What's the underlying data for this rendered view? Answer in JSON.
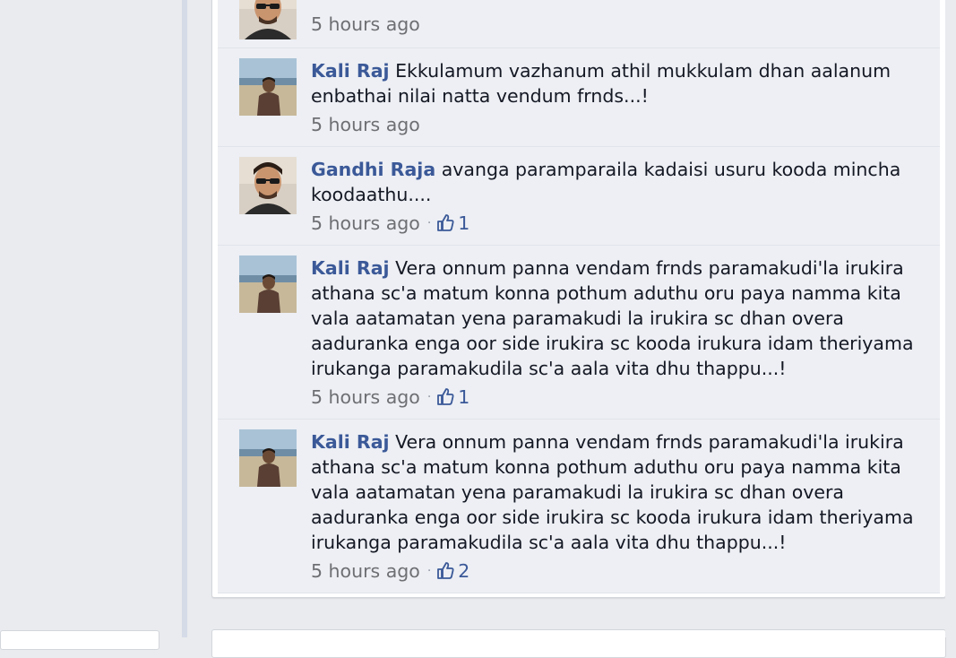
{
  "comments": [
    {
      "author": "",
      "text": "",
      "time": "5 hours ago",
      "likes": null,
      "avatar": "avatar-sunglasses-man"
    },
    {
      "author": "Kali Raj",
      "text": "Ekkulamum vazhanum athil mukkulam dhan aalanum enbathai nilai natta vendum frnds...!",
      "time": "5 hours ago",
      "likes": null,
      "avatar": "avatar-beach-man"
    },
    {
      "author": "Gandhi Raja",
      "text": "avanga paramparaila kadaisi usuru kooda mincha koodaathu....",
      "time": "5 hours ago",
      "likes": "1",
      "avatar": "avatar-sunglasses-man"
    },
    {
      "author": "Kali Raj",
      "text": "Vera onnum panna vendam frnds paramakudi'la irukira athana sc'a matum konna pothum aduthu oru paya namma kita vala aatamatan yena paramakudi la irukira sc dhan overa aaduranka enga oor side irukira sc kooda irukura idam theriyama irukanga paramakudila sc'a aala vita dhu thappu...!",
      "time": "5 hours ago",
      "likes": "1",
      "avatar": "avatar-beach-man"
    },
    {
      "author": "Kali Raj",
      "text": "Vera onnum panna vendam frnds paramakudi'la irukira athana sc'a matum konna pothum aduthu oru paya namma kita vala aatamatan yena paramakudi la irukira sc dhan overa aaduranka enga oor side irukira sc kooda irukura idam theriyama irukanga paramakudila sc'a aala vita dhu thappu...!",
      "time": "5 hours ago",
      "likes": "2",
      "avatar": "avatar-beach-man"
    }
  ],
  "colors": {
    "author": "#3b5998",
    "comment_bg": "#edeff4",
    "page_bg": "#e9ebee",
    "meta": "#6d6f73"
  },
  "icons": {
    "like": "thumbs-up-icon"
  }
}
